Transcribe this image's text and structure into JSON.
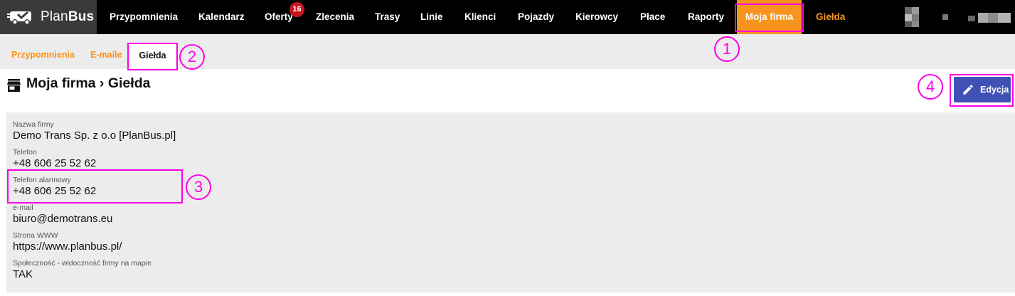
{
  "app": {
    "logo_plan": "Plan",
    "logo_bus": "Bus"
  },
  "nav": {
    "items": [
      {
        "label": "Przypomnienia"
      },
      {
        "label": "Kalendarz"
      },
      {
        "label": "Oferty"
      },
      {
        "label": "Zlecenia"
      },
      {
        "label": "Trasy"
      },
      {
        "label": "Linie"
      },
      {
        "label": "Klienci"
      },
      {
        "label": "Pojazdy"
      },
      {
        "label": "Kierowcy"
      },
      {
        "label": "Płace"
      },
      {
        "label": "Raporty"
      },
      {
        "label": "Moja firma"
      },
      {
        "label": "Giełda"
      }
    ],
    "offers_badge": "16",
    "active_item": "Moja firma"
  },
  "subnav": {
    "tabs": [
      {
        "label": "Przypomnienia"
      },
      {
        "label": "E-maile"
      },
      {
        "label": "Giełda"
      }
    ],
    "active_tab": "Giełda"
  },
  "page": {
    "title": "Moja firma › Giełda",
    "edit_label": "Edycja"
  },
  "fields": [
    {
      "label": "Nazwa firmy",
      "value": "Demo Trans Sp. z o.o [PlanBus.pl]"
    },
    {
      "label": "Telefon",
      "value": "+48 606 25 52 62"
    },
    {
      "label": "Telefon alarmowy",
      "value": "+48 606 25 52 62"
    },
    {
      "label": "e-mail",
      "value": "biuro@demotrans.eu"
    },
    {
      "label": "Strona WWW",
      "value": "https://www.planbus.pl/"
    },
    {
      "label": "Społeczność - widoczność firmy na mapie",
      "value": "TAK"
    }
  ],
  "annotations": {
    "marker_1": "1",
    "marker_2": "2",
    "marker_3": "3",
    "marker_4": "4"
  },
  "colors": {
    "accent_orange": "#f7941d",
    "edit_button": "#3f51b5",
    "badge_red": "#c8161d",
    "annotation_magenta": "#ff00e6"
  },
  "icons": {
    "logo": "bus-logo-icon",
    "title": "store-icon",
    "edit": "pencil-icon"
  }
}
